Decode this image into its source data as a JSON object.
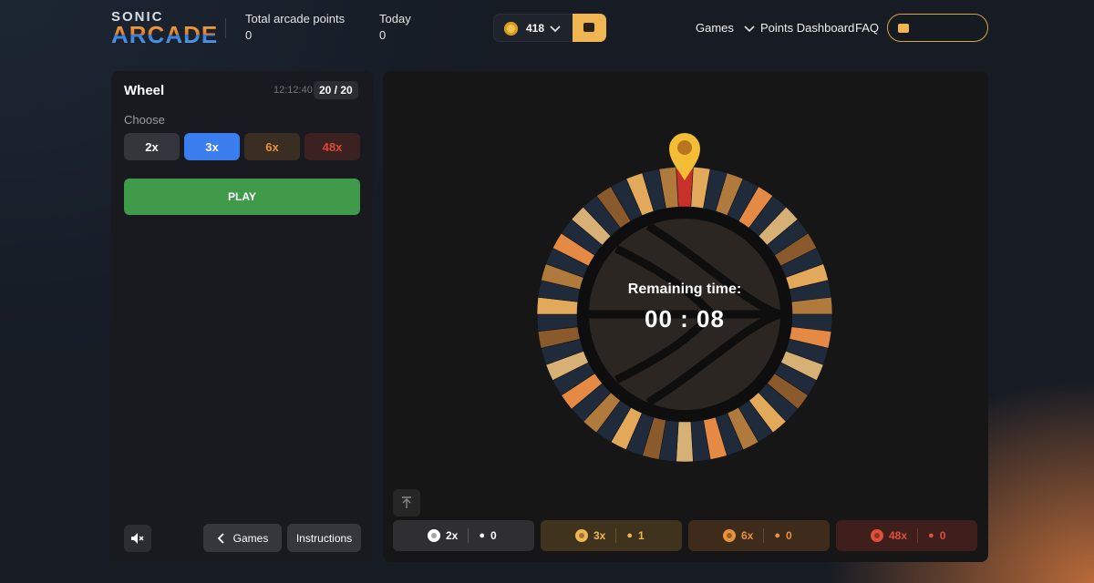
{
  "header": {
    "logo_top": "SONIC",
    "logo_bottom": "ARCADE",
    "total_points_label": "Total arcade points",
    "total_points_value": "0",
    "today_label": "Today",
    "today_value": "0",
    "wallet_amount": "418",
    "nav": {
      "games": "Games",
      "points_dashboard": "Points Dashboard",
      "faq": "FAQ"
    }
  },
  "game": {
    "title": "Wheel",
    "time": "12:12:40",
    "count": "20 / 20",
    "choose_label": "Choose",
    "multipliers": [
      "2x",
      "3x",
      "6x",
      "48x"
    ],
    "selected_multiplier": "3x",
    "play_label": "PLAY",
    "games_button": "Games",
    "instructions_button": "Instructions"
  },
  "wheel": {
    "remaining_label": "Remaining time:",
    "remaining_value": "00 : 08"
  },
  "bets": [
    {
      "mult": "2x",
      "players": "0"
    },
    {
      "mult": "3x",
      "players": "1"
    },
    {
      "mult": "6x",
      "players": "0"
    },
    {
      "mult": "48x",
      "players": "0"
    }
  ],
  "colors": {
    "accent_blue": "#3a7ef0",
    "gold": "#f0b651",
    "orange": "#e8923e",
    "red": "#e0503a",
    "green": "#3f9b4a",
    "wheel_navy": "#1f2a3a"
  }
}
